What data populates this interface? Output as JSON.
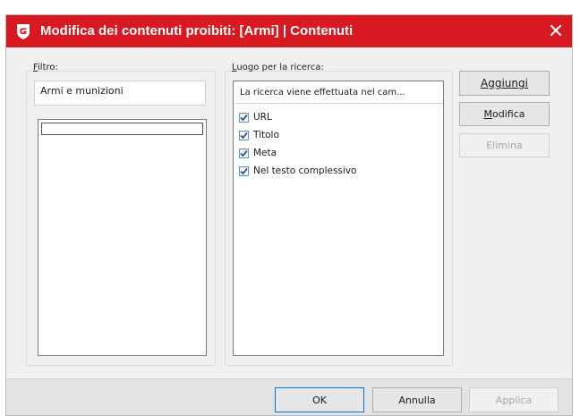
{
  "window": {
    "title": "Modifica dei contenuti proibiti: [Armi] | Contenuti",
    "accent_color": "#d81922",
    "app_icon": "g-data-shield-icon",
    "close_icon": "close-icon"
  },
  "filter_group": {
    "label_mnemonic": "F",
    "label_rest": "iltro:",
    "value": "Armi e munizioni",
    "list_items": [
      ""
    ]
  },
  "search_group": {
    "label_mnemonic": "L",
    "label_rest": "uogo per la ricerca:",
    "list_header": "La ricerca viene effettuata nel cam...",
    "items": [
      {
        "label": "URL",
        "checked": true
      },
      {
        "label": "Titolo",
        "checked": true
      },
      {
        "label": "Meta",
        "checked": true
      },
      {
        "label": "Nel testo complessivo",
        "checked": true
      }
    ]
  },
  "side_buttons": {
    "add": "Aggiungi",
    "edit_mnemonic": "M",
    "edit_rest": "odifica",
    "delete": "Elimina"
  },
  "footer": {
    "ok": "OK",
    "cancel": "Annulla",
    "apply": "Applica"
  }
}
